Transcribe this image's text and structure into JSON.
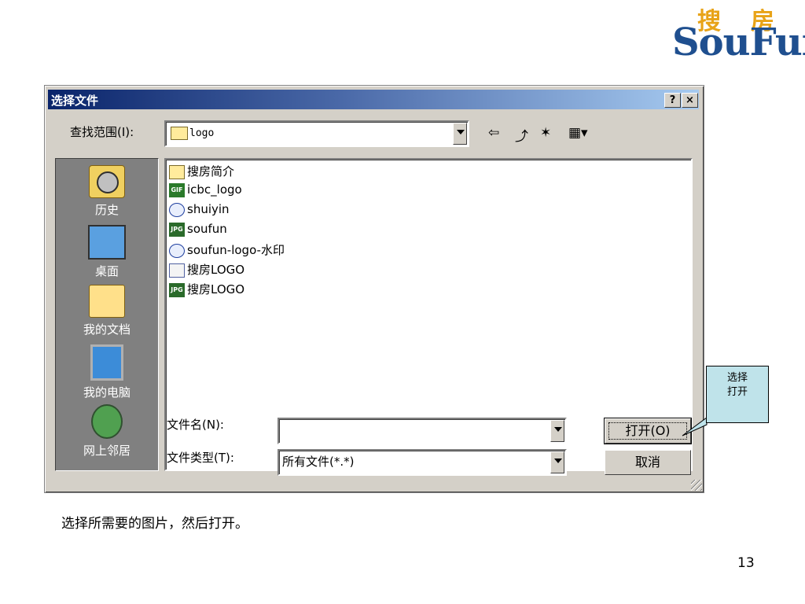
{
  "logo": {
    "cn_left": "搜",
    "cn_right": "房",
    "en": "SouFun"
  },
  "dialog": {
    "title": "选择文件",
    "help_button": "?",
    "close_button": "×",
    "look_in_label": "查找范围(I):",
    "look_in_value": "logo",
    "places": [
      {
        "label": "历史",
        "icon": "history-icon"
      },
      {
        "label": "桌面",
        "icon": "desktop-icon"
      },
      {
        "label": "我的文档",
        "icon": "my-documents-icon"
      },
      {
        "label": "我的电脑",
        "icon": "my-computer-icon"
      },
      {
        "label": "网上邻居",
        "icon": "network-icon"
      }
    ],
    "files": [
      {
        "name": "搜房简介",
        "type": "folder"
      },
      {
        "name": "icbc_logo",
        "type": "gif",
        "badge": "GIF"
      },
      {
        "name": "shuiyin",
        "type": "image"
      },
      {
        "name": "soufun",
        "type": "jpg",
        "badge": "JPG"
      },
      {
        "name": "soufun-logo-水印",
        "type": "image"
      },
      {
        "name": "搜房LOGO",
        "type": "document"
      },
      {
        "name": "搜房LOGO",
        "type": "jpg",
        "badge": "JPG"
      }
    ],
    "file_name_label": "文件名(N):",
    "file_name_value": "",
    "file_type_label": "文件类型(T):",
    "file_type_value": "所有文件(*.*)",
    "open_button": "打开(O)",
    "cancel_button": "取消"
  },
  "callout": {
    "line1": "选择",
    "line2": "打开"
  },
  "caption": "选择所需要的图片，然后打开。",
  "page_number": "13"
}
